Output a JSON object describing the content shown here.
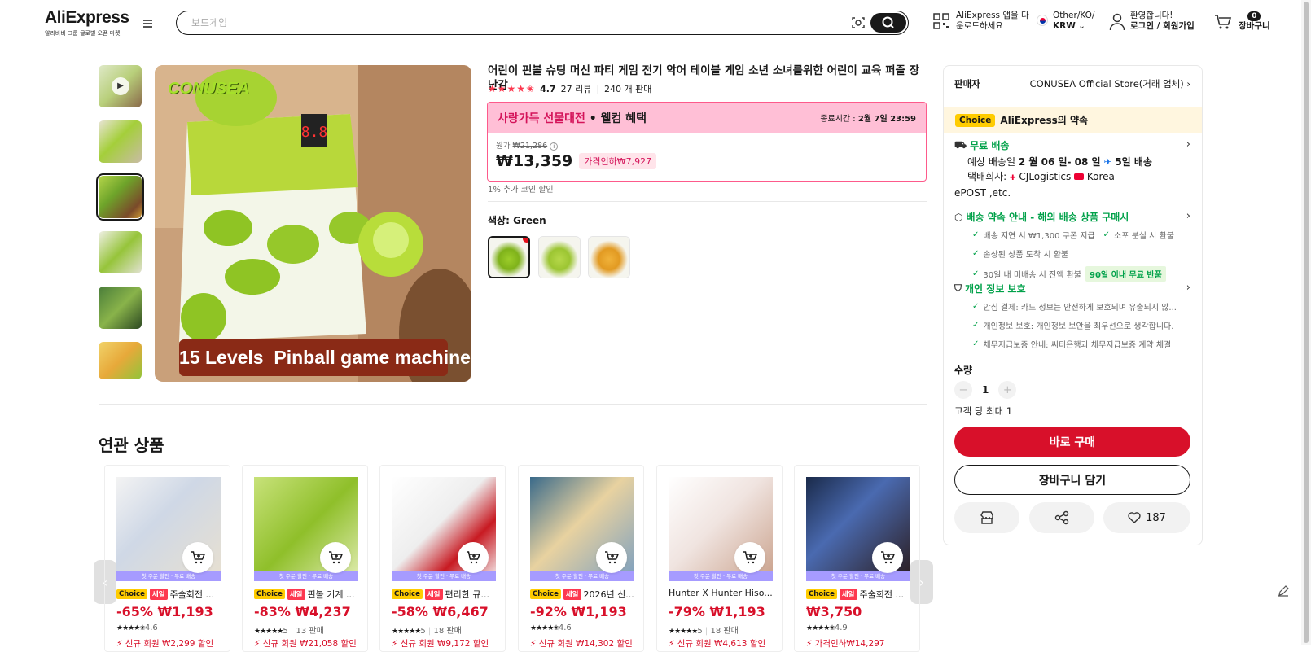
{
  "header": {
    "logo": "AliExpress",
    "logo_sub": "알리바바 그룹 글로벌 오픈 마켓",
    "search_placeholder": "보드게임",
    "app_line1": "AliExpress 앱을 다",
    "app_line2": "운로드하세요",
    "region_line1": "Other/KO/",
    "region_line2": "KRW",
    "account_line1": "환영합니다!",
    "account_line2": "로그인 / 회원가입",
    "cart_count": "0",
    "cart_label": "장바구니"
  },
  "product": {
    "title": "어린이 핀볼 슈팅 머신 파티 게임 전기 악어 테이블 게임 소년 소녀를위한 어린이 교육 퍼즐 장난감",
    "rating": "4.7",
    "reviews": "27 리뷰",
    "sold": "240 개 판매",
    "main_image_brand": "CONUSEA",
    "main_image_caption": "15 Levels  Pinball game machine",
    "promo": {
      "title_red": "사랑가득 선물대전",
      "title_rest": " • 웰컴 혜택",
      "end_label": "종료시간 :",
      "end_time": "2월 7일 23:59",
      "orig_label": "원가",
      "orig_price": "₩21,286",
      "price": "₩13,359",
      "discount": "가격인하₩7,927"
    },
    "coin_text": "1% 추가 코인 할인",
    "color_label": "색상: ",
    "color_value": "Green"
  },
  "panel": {
    "seller_label": "판매자",
    "seller_name": "CONUSEA Official Store(거래 업체)",
    "choice_badge": "Choice",
    "promise": "AliExpress의 약속",
    "shipping_title": "무료 배송",
    "shipping_line1_a": "예상 배송일 ",
    "shipping_line1_b": "2 월 06 일- 08 일",
    "shipping_line1_c": "5일 배송",
    "shipping_carrier_label": "택배회사: ",
    "shipping_carrier_1": "CJLogistics",
    "shipping_carrier_2": "Korea",
    "shipping_carrier_3": "ePOST ,etc.",
    "guarantee_title": "배송 약속 안내 - 해외 배송 상품 구매시",
    "guarantee_1": "배송 지연 시 ₩1,300 쿠폰 지급",
    "guarantee_2": "소포 분실 시 환불",
    "guarantee_3": "손상된 상품 도착 시 환불",
    "guarantee_4": "30일 내 미배송 시 전액 환불",
    "guarantee_badge": "90일 이내 무료 반품",
    "privacy_title": "개인 정보 보호",
    "privacy_1": "안심 결제: 카드 정보는 안전하게 보호되며 유출되지 않...",
    "privacy_2": "개인정보 보호: 개인정보 보안을 최우선으로 생각합니다.",
    "privacy_3": "채무지급보증 안내: 씨티은행과 채무지급보증 계약 체결",
    "qty_label": "수량",
    "qty_minus": "−",
    "qty_value": "1",
    "qty_plus": "+",
    "qty_limit": "고객 당 최대 1",
    "buy_now": "바로 구매",
    "add_cart": "장바구니 담기",
    "wish_count": "187"
  },
  "related": {
    "title": "연관 상품",
    "ribbon": "첫 주문 할인 · 무료 배송",
    "items": [
      {
        "title": "주술회전 ...",
        "choice": "Choice",
        "sale": "세일",
        "discount": "-65%",
        "price": "₩1,193",
        "stars": "★★★★✬",
        "rating": "4.6",
        "sold": "",
        "promo": "신규 회원 ₩2,299 할인"
      },
      {
        "title": "핀볼 기계 ...",
        "choice": "Choice",
        "sale": "세일",
        "discount": "-83%",
        "price": "₩4,237",
        "stars": "★★★★★",
        "rating": "5",
        "sold": "13 판매",
        "promo": "신규 회원 ₩21,058 할인"
      },
      {
        "title": "편리한 규...",
        "choice": "Choice",
        "sale": "세일",
        "discount": "-58%",
        "price": "₩6,467",
        "stars": "★★★★★",
        "rating": "5",
        "sold": "18 판매",
        "promo": "신규 회원 ₩9,172 할인"
      },
      {
        "title": "2026년 신...",
        "choice": "Choice",
        "sale": "세일",
        "discount": "-92%",
        "price": "₩1,193",
        "stars": "★★★★✬",
        "rating": "4.6",
        "sold": "",
        "promo": "신규 회원 ₩14,302 할인"
      },
      {
        "title": "Hunter X Hunter Hiso...",
        "choice": "",
        "sale": "",
        "discount": "-79%",
        "price": "₩1,193",
        "stars": "★★★★★",
        "rating": "5",
        "sold": "18 판매",
        "promo": "신규 회원 ₩4,613 할인"
      },
      {
        "title": "주술회전 ...",
        "choice": "Choice",
        "sale": "세일",
        "discount": "",
        "price": "₩3,750",
        "stars": "★★★★✬",
        "rating": "4.9",
        "sold": "",
        "promo": "가격인하₩14,297"
      }
    ]
  },
  "colors": {
    "accent_red": "#d8102a",
    "choice_yellow": "#ffcc00",
    "green": "#00a149",
    "promo_pink": "#ffbfd6"
  }
}
